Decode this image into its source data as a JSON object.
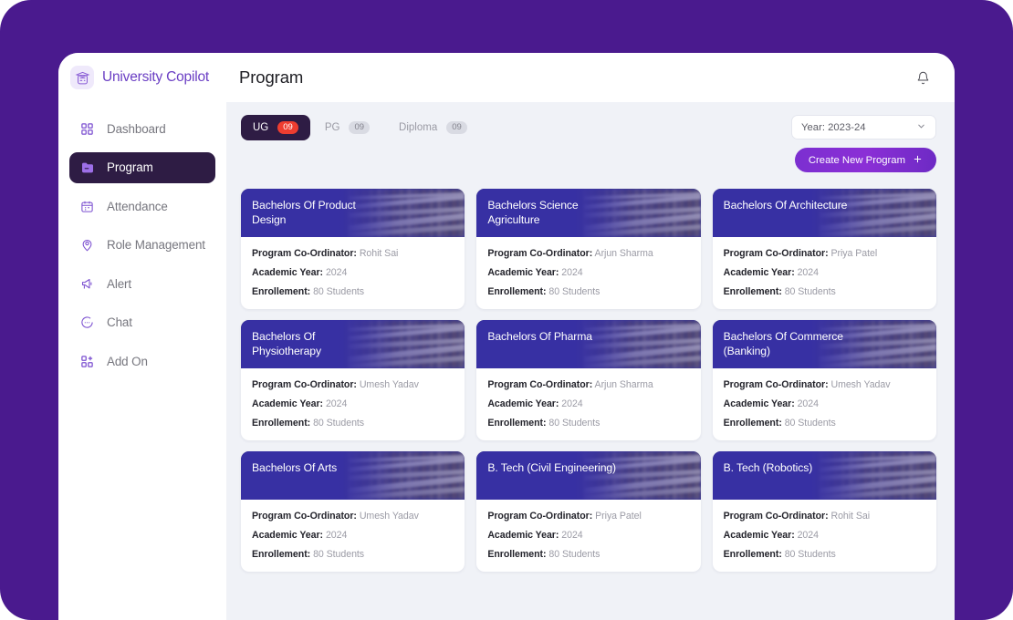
{
  "theme": {
    "canvas_purple": "#4a1a8e",
    "content_bg": "#f0f2f7",
    "active_nav": "#2e1c44",
    "brand_purple": "#6b3fc4",
    "badge_red": "#ee3d30",
    "card_header_indigo": "#3730a3"
  },
  "brand": {
    "name": "University Copilot",
    "logo_icon": "graduation-cap-icon"
  },
  "header": {
    "title": "Program",
    "bell_icon": "bell-icon"
  },
  "sidebar": {
    "items": [
      {
        "label": "Dashboard",
        "icon": "grid-dots-icon",
        "active": false
      },
      {
        "label": "Program",
        "icon": "folder-icon",
        "active": true
      },
      {
        "label": "Attendance",
        "icon": "calendar-icon",
        "active": false
      },
      {
        "label": "Role Management",
        "icon": "user-pin-icon",
        "active": false
      },
      {
        "label": "Alert",
        "icon": "megaphone-icon",
        "active": false
      },
      {
        "label": "Chat",
        "icon": "chat-bubble-icon",
        "active": false
      },
      {
        "label": "Add On",
        "icon": "add-grid-icon",
        "active": false
      }
    ]
  },
  "tabs": [
    {
      "label": "UG",
      "count": "09",
      "active": true
    },
    {
      "label": "PG",
      "count": "09",
      "active": false
    },
    {
      "label": "Diploma",
      "count": "09",
      "active": false
    }
  ],
  "year_select": {
    "value": "Year: 2023-24",
    "chevron_icon": "chevron-down-icon"
  },
  "create_button": {
    "label": "Create New Program",
    "icon": "plus-icon"
  },
  "card_labels": {
    "coordinator": "Program Co-Ordinator:",
    "academic_year": "Academic Year:",
    "enrollement": "Enrollement:"
  },
  "programs": [
    {
      "title": "Bachelors Of Product Design",
      "coordinator": "Rohit Sai",
      "year": "2024",
      "enrollement": "80 Students"
    },
    {
      "title": "Bachelors Science Agriculture",
      "coordinator": "Arjun Sharma",
      "year": "2024",
      "enrollement": "80 Students"
    },
    {
      "title": "Bachelors Of Architecture",
      "coordinator": "Priya Patel",
      "year": "2024",
      "enrollement": "80 Students"
    },
    {
      "title": "Bachelors Of Physiotherapy",
      "coordinator": "Umesh Yadav",
      "year": "2024",
      "enrollement": "80 Students"
    },
    {
      "title": "Bachelors Of Pharma",
      "coordinator": "Arjun Sharma",
      "year": "2024",
      "enrollement": "80 Students"
    },
    {
      "title": "Bachelors Of Commerce (Banking)",
      "coordinator": "Umesh Yadav",
      "year": "2024",
      "enrollement": "80 Students"
    },
    {
      "title": "Bachelors Of Arts",
      "coordinator": "Umesh Yadav",
      "year": "2024",
      "enrollement": "80 Students"
    },
    {
      "title": "B. Tech (Civil Engineering)",
      "coordinator": "Priya Patel",
      "year": "2024",
      "enrollement": "80 Students"
    },
    {
      "title": "B. Tech (Robotics)",
      "coordinator": "Rohit Sai",
      "year": "2024",
      "enrollement": "80 Students"
    }
  ]
}
